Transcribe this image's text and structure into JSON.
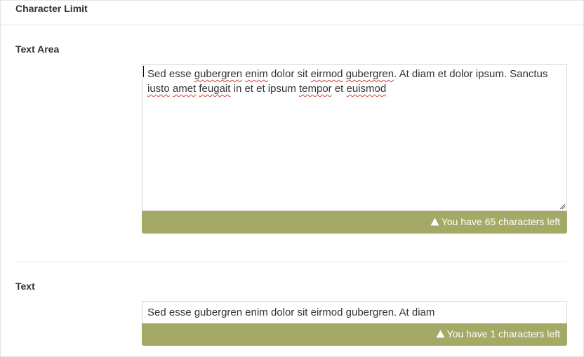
{
  "section": {
    "title": "Character Limit"
  },
  "textarea_field": {
    "label": "Text Area",
    "value_words": [
      {
        "t": "Sed esse ",
        "spell": false
      },
      {
        "t": "gubergren",
        "spell": true
      },
      {
        "t": " ",
        "spell": false
      },
      {
        "t": "enim",
        "spell": true
      },
      {
        "t": " dolor sit ",
        "spell": false
      },
      {
        "t": "eirmod",
        "spell": true
      },
      {
        "t": " ",
        "spell": false
      },
      {
        "t": "gubergren",
        "spell": true
      },
      {
        "t": ". At diam et dolor ipsum. Sanctus ",
        "spell": false
      },
      {
        "t": "iusto",
        "spell": true
      },
      {
        "t": " ",
        "spell": false
      },
      {
        "t": "amet",
        "spell": true
      },
      {
        "t": " ",
        "spell": false
      },
      {
        "t": "feugait",
        "spell": true
      },
      {
        "t": " in et et ipsum ",
        "spell": false
      },
      {
        "t": "tempor",
        "spell": true
      },
      {
        "t": " et ",
        "spell": false
      },
      {
        "t": "euismod",
        "spell": true
      }
    ],
    "counter_text": "You have 65 characters left"
  },
  "text_field": {
    "label": "Text",
    "value": "Sed esse gubergren enim dolor sit eirmod gubergren. At diam",
    "counter_text": "You have 1 characters left"
  },
  "colors": {
    "counter_bg": "#a4aa66",
    "counter_text": "#ffffff",
    "spellcheck": "#d04040"
  },
  "icons": {
    "counter_icon": "warning-triangle-icon"
  }
}
